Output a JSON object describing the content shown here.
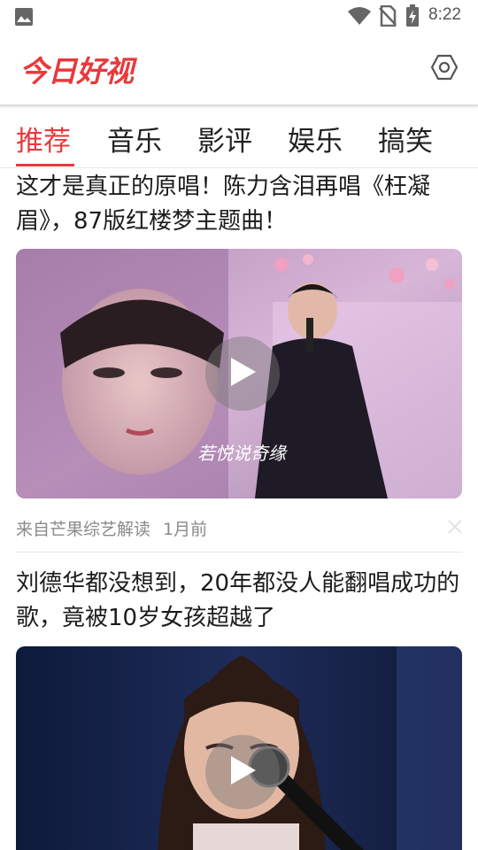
{
  "status_bar": {
    "time": "8:22",
    "icons": [
      "gallery-icon",
      "wifi-icon",
      "no-sim-icon",
      "battery-icon"
    ]
  },
  "header": {
    "logo_text": "今日好视",
    "settings_icon": "settings-hexagon-icon"
  },
  "tabs": [
    {
      "label": "推荐",
      "active": true
    },
    {
      "label": "音乐",
      "active": false
    },
    {
      "label": "影评",
      "active": false
    },
    {
      "label": "娱乐",
      "active": false
    },
    {
      "label": "搞笑",
      "active": false
    }
  ],
  "feed": [
    {
      "title": "这才是真正的原唱！陈力含泪再唱《枉凝眉》，87版红楼梦主题曲！",
      "source": "来自芒果综艺解读",
      "time_ago": "1月前",
      "has_video": true,
      "overlay_caption": "若悦说奇缘"
    },
    {
      "title": "刘德华都没想到，20年都没人能翻唱成功的歌，竟被10岁女孩超越了",
      "has_video": true
    }
  ],
  "colors": {
    "accent": "#e8393c",
    "text": "#1c1c1c",
    "meta": "#8a8a8a"
  }
}
